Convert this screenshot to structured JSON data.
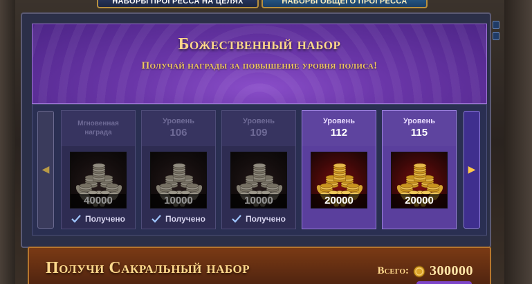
{
  "tabs": [
    {
      "label": "Наборы прогресса на целях"
    },
    {
      "label": "Наборы общего прогресса"
    }
  ],
  "banner": {
    "title": "Божественный набор",
    "subtitle": "Получай награды за повышение уровня полиса!"
  },
  "rewards": [
    {
      "head": "Мгновенная награда",
      "level": "",
      "amount": "40000",
      "status": "Получено",
      "state": "claimed"
    },
    {
      "head": "Уровень",
      "level": "106",
      "amount": "10000",
      "status": "Получено",
      "state": "claimed"
    },
    {
      "head": "Уровень",
      "level": "109",
      "amount": "10000",
      "status": "Получено",
      "state": "claimed"
    },
    {
      "head": "Уровень",
      "level": "112",
      "amount": "20000",
      "status": "",
      "state": "available"
    },
    {
      "head": "Уровень",
      "level": "115",
      "amount": "20000",
      "status": "",
      "state": "available"
    }
  ],
  "bottom": {
    "title": "Получи Сакральный набор",
    "total_label": "Всего:",
    "total_value": "300000"
  },
  "colors": {
    "banner_purple": "#6a36a8",
    "title_gold": "#ffd88a",
    "active_card": "#5a3f9d",
    "bottom_panel": "#7a3a14"
  },
  "icons": {
    "reward": "gold-coins-laurel-icon",
    "claimed": "checkmark-icon",
    "currency": "coin-icon",
    "prev": "chevron-left-icon",
    "next": "chevron-right-icon"
  }
}
